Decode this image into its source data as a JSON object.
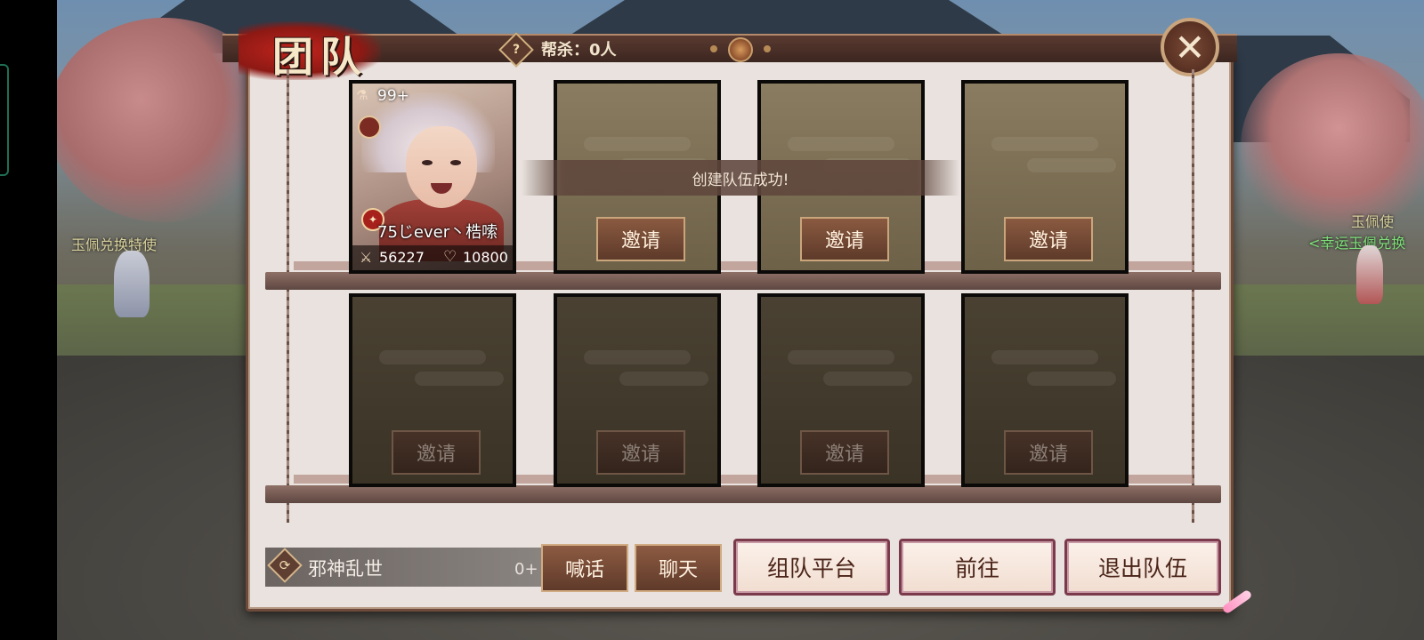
{
  "header": {
    "title": "团队",
    "kill_icon_glyph": "?",
    "kill_count": "帮杀：0人",
    "close_glyph": "✕"
  },
  "world": {
    "npc_left": "玉佩兑换特使",
    "npc_right_name": "玉佩使",
    "npc_right_sub": "<幸运玉佩兑换"
  },
  "member": {
    "count": "99+",
    "level_name": "75じever丶梏嗦",
    "power": "56227",
    "hp": "10800"
  },
  "toast": "创建队伍成功!",
  "slots": [
    {
      "invite": "邀请"
    },
    {
      "invite": "邀请"
    },
    {
      "invite": "邀请"
    },
    {
      "invite": "邀请"
    },
    {
      "invite": "邀请"
    },
    {
      "invite": "邀请"
    },
    {
      "invite": "邀请"
    }
  ],
  "bottom": {
    "channel_icon_glyph": "⟳",
    "channel_name": "邪神乱世",
    "channel_count": "0+",
    "shout": "喊话",
    "chat": "聊天",
    "team_platform": "组队平台",
    "go": "前往",
    "leave": "退出队伍"
  },
  "colors": {
    "accent_brown": "#5f3a2a",
    "panel_bg": "#e9e2de",
    "pink_border": "#7b3a4c"
  }
}
